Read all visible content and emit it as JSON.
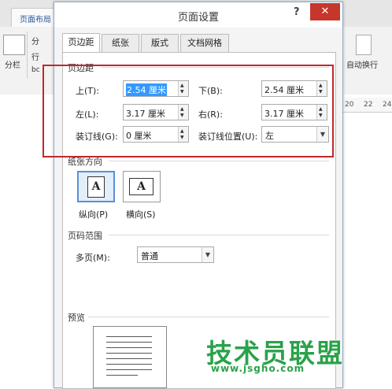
{
  "background": {
    "ribbon_tab": "页面布局",
    "ribbon_left_label": "分栏",
    "ribbon_small_1": "分",
    "ribbon_small_2": "行",
    "ribbon_small_3": "bc",
    "ribbon_right_label": "自动换行",
    "ruler_ticks": [
      "20",
      "22",
      "24"
    ]
  },
  "dialog": {
    "title": "页面设置",
    "help_label": "?",
    "close_label": "✕",
    "tabs": [
      {
        "label": "页边距",
        "active": true
      },
      {
        "label": "纸张",
        "active": false
      },
      {
        "label": "版式",
        "active": false
      },
      {
        "label": "文档网格",
        "active": false
      }
    ],
    "margins": {
      "section": "页边距",
      "top_label": "上(T):",
      "top_value": "2.54 厘米",
      "bottom_label": "下(B):",
      "bottom_value": "2.54 厘米",
      "left_label": "左(L):",
      "left_value": "3.17 厘米",
      "right_label": "右(R):",
      "right_value": "3.17 厘米",
      "gutter_label": "装订线(G):",
      "gutter_value": "0 厘米",
      "gutter_pos_label": "装订线位置(U):",
      "gutter_pos_value": "左"
    },
    "orientation": {
      "section": "纸张方向",
      "portrait_label": "纵向(P)",
      "landscape_label": "横向(S)",
      "glyph": "A",
      "selected": "portrait"
    },
    "pages": {
      "section": "页码范围",
      "multiple_label": "多页(M):",
      "multiple_value": "普通"
    },
    "preview": {
      "section": "预览"
    }
  },
  "watermark": {
    "text": "技术员联盟",
    "url": "www.jsgho.com"
  },
  "colors": {
    "highlight": "#c0282c",
    "close": "#c7362b",
    "selection": "#3399ff",
    "watermark": "#2aa24a"
  }
}
